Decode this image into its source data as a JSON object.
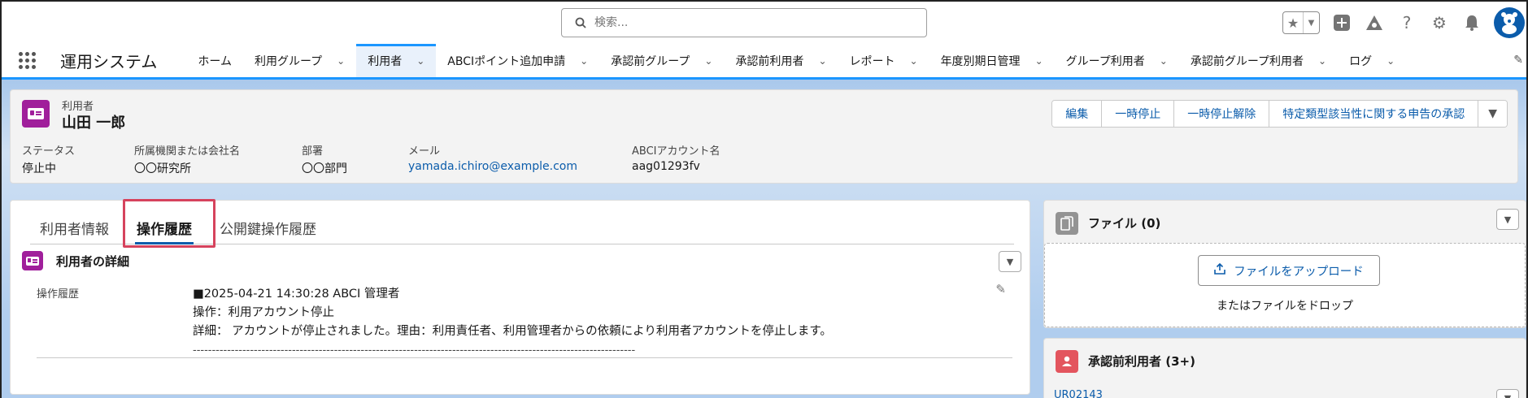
{
  "search": {
    "placeholder": "検索..."
  },
  "app": {
    "name": "運用システム"
  },
  "nav": {
    "items": [
      {
        "label": "ホーム",
        "has_menu": false
      },
      {
        "label": "利用グループ",
        "has_menu": true
      },
      {
        "label": "利用者",
        "has_menu": true,
        "active": true
      },
      {
        "label": "ABCIポイント追加申請",
        "has_menu": true
      },
      {
        "label": "承認前グループ",
        "has_menu": true
      },
      {
        "label": "承認前利用者",
        "has_menu": true
      },
      {
        "label": "レポート",
        "has_menu": true
      },
      {
        "label": "年度別期日管理",
        "has_menu": true
      },
      {
        "label": "グループ利用者",
        "has_menu": true
      },
      {
        "label": "承認前グループ利用者",
        "has_menu": true
      },
      {
        "label": "ログ",
        "has_menu": true
      }
    ]
  },
  "record": {
    "type": "利用者",
    "name": "山田 一郎",
    "actions": [
      "編集",
      "一時停止",
      "一時停止解除",
      "特定類型該当性に関する申告の承認"
    ],
    "highlights": [
      {
        "label": "ステータス",
        "value": "停止中",
        "link": false
      },
      {
        "label": "所属機関または会社名",
        "value": "〇〇研究所",
        "link": false
      },
      {
        "label": "部署",
        "value": "〇〇部門",
        "link": false
      },
      {
        "label": "メール",
        "value": "yamada.ichiro@example.com",
        "link": true
      },
      {
        "label": "ABCIアカウント名",
        "value": "aag01293fv",
        "link": false
      }
    ]
  },
  "tabs": [
    {
      "label": "利用者情報",
      "active": false
    },
    {
      "label": "操作履歴",
      "active": true
    },
    {
      "label": "公開鍵操作履歴",
      "active": false
    }
  ],
  "section": {
    "title": "利用者の詳細",
    "field": {
      "label": "操作履歴",
      "lines": [
        "■2025-04-21 14:30:28 ABCI 管理者",
        "操作：利用アカウント停止",
        "詳細： アカウントが停止されました。理由：利用責任者、利用管理者からの依頼により利用者アカウントを停止します。",
        "--------------------------------------------------------------------------------------------------------------------"
      ]
    }
  },
  "files": {
    "title": "ファイル (0)",
    "upload_label": "ファイルをアップロード",
    "drop_text": "またはファイルをドロップ",
    "icon_color": "#939393"
  },
  "pending": {
    "title": "承認前利用者 (3+)",
    "first_link": "UR02143",
    "icon_color": "#e3555e"
  },
  "colors": {
    "brand": "#0b5cab",
    "record_icon": "#a01f9b",
    "nav_accent": "#1b96ff",
    "highlight_box": "#d6435d"
  }
}
